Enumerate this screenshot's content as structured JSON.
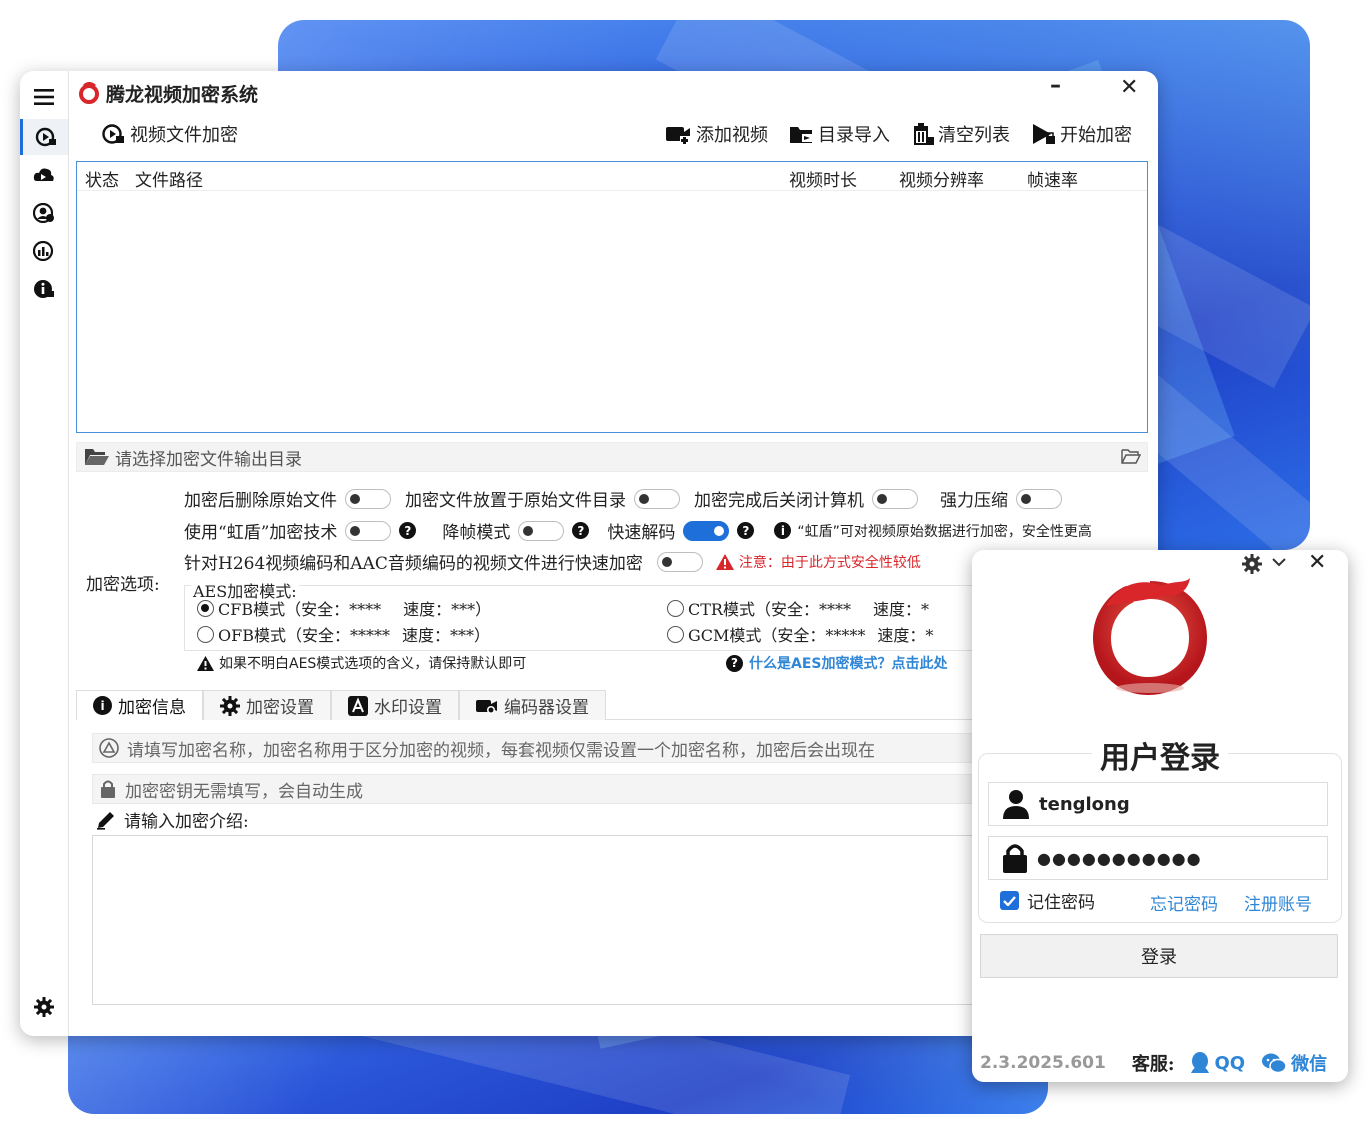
{
  "app": {
    "title": "腾龙视频加密系统",
    "minimize": "–",
    "close": "✕"
  },
  "sidebar": {
    "items": [
      {
        "name": "menu-icon"
      },
      {
        "name": "video-encrypt-icon"
      },
      {
        "name": "cloud-icon"
      },
      {
        "name": "user-icon"
      },
      {
        "name": "stats-icon"
      },
      {
        "name": "info-icon"
      }
    ],
    "settings_icon": "gear-icon"
  },
  "toolbar": {
    "section_title": "视频文件加密",
    "add_video": "添加视频",
    "import_dir": "目录导入",
    "clear_list": "清空列表",
    "start_encrypt": "开始加密"
  },
  "file_list": {
    "columns": [
      "状态",
      "文件路径",
      "视频时长",
      "视频分辨率",
      "帧速率"
    ]
  },
  "output_dir": {
    "placeholder": "请选择加密文件输出目录"
  },
  "options": {
    "delete_original": "加密后删除原始文件",
    "place_in_original": "加密文件放置于原始文件目录",
    "shutdown_after": "加密完成后关闭计算机",
    "strong_compress": "强力压缩",
    "rainbow_shield": "使用“虹盾”加密技术",
    "reduce_fps": "降帧模式",
    "fast_decode": "快速解码",
    "rainbow_note": "“虹盾”可对视频原始数据进行加密，安全性更高",
    "fast_encrypt": "针对H264视频编码和AAC音频编码的视频文件进行快速加密",
    "fast_encrypt_warning": "注意：由于此方式安全性较低",
    "encrypt_options_label": "加密选项:",
    "aes_label": "AES加密模式:",
    "aes_modes": [
      {
        "label": "CFB模式（安全：****",
        "speed": "速度：***）",
        "selected": true
      },
      {
        "label": "CTR模式（安全：****",
        "speed": "速度：*",
        "selected": false
      },
      {
        "label": "OFB模式（安全：*****",
        "speed": "速度：***）",
        "selected": false
      },
      {
        "label": "GCM模式（安全：*****",
        "speed": "速度：*",
        "selected": false
      }
    ],
    "aes_hint": "如果不明白AES模式选项的含义，请保持默认即可",
    "aes_help_link": "什么是AES加密模式？点击此处"
  },
  "tabs": [
    {
      "label": "加密信息",
      "icon": "info-icon",
      "active": true
    },
    {
      "label": "加密设置",
      "icon": "gear-icon",
      "active": false
    },
    {
      "label": "水印设置",
      "icon": "watermark-icon",
      "active": false
    },
    {
      "label": "编码器设置",
      "icon": "encoder-icon",
      "active": false
    }
  ],
  "encrypt_info": {
    "name_placeholder": "请填写加密名称，加密名称用于区分加密的视频，每套视频仅需设置一个加密名称，加密后会出现在",
    "key_placeholder": "加密密钥无需填写，会自动生成",
    "desc_label": "请输入加密介绍:"
  },
  "login": {
    "title": "用户登录",
    "username": "tenglong",
    "password": "●●●●●●●●●●●",
    "remember": "记住密码",
    "forgot": "忘记密码",
    "register": "注册账号",
    "login_button": "登录",
    "version": "2.3.2025.601",
    "service_label": "客服:",
    "qq": "QQ",
    "wechat": "微信",
    "close": "✕"
  },
  "colors": {
    "accent": "#1e6fd9",
    "link": "#2f86d6",
    "warning": "#d8262b",
    "logo_red": "#d8262b"
  }
}
